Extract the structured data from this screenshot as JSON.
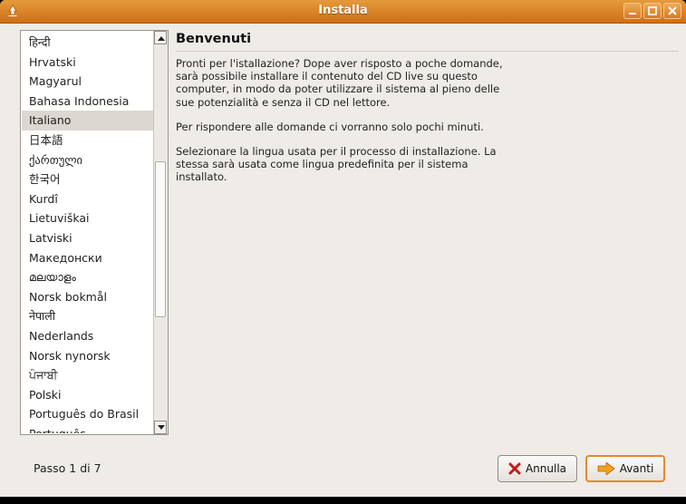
{
  "window": {
    "title": "Installa"
  },
  "languages": {
    "items": [
      "हिन्दी",
      "Hrvatski",
      "Magyarul",
      "Bahasa Indonesia",
      "Italiano",
      "日本語",
      "ქართული",
      "한국어",
      "Kurdî",
      "Lietuviškai",
      "Latviski",
      "Македонски",
      "മലയാളം",
      "Norsk bokmål",
      "नेपाली",
      "Nederlands",
      "Norsk nynorsk",
      "ਪੰਜਾਬੀ",
      "Polski",
      "Português do Brasil",
      "Português"
    ],
    "selected": "Italiano"
  },
  "main": {
    "heading": "Benvenuti",
    "paragraphs": [
      "Pronti per l'istallazione? Dope aver risposto a poche domande,\nsarà possibile installare il contenuto del CD live su questo\ncomputer, in modo da poter utilizzare il sistema al pieno delle\nsue potenzialità e senza il CD nel lettore.",
      "Per rispondere alle domande ci vorranno solo pochi minuti.",
      "Selezionare la lingua usata per il processo di installazione. La\nstessa sarà usata come lingua predefinita per il sistema\ninstallato."
    ]
  },
  "footer": {
    "step": "Passo 1 di 7",
    "cancel_label": "Annulla",
    "next_label": "Avanti"
  },
  "colors": {
    "titlebar": "#d8802a",
    "accent": "#e38a2a",
    "window_bg": "#efebe7",
    "selected_row": "#dcd7d0"
  },
  "icons": {
    "cancel": "x-icon",
    "next": "arrow-right-icon"
  }
}
